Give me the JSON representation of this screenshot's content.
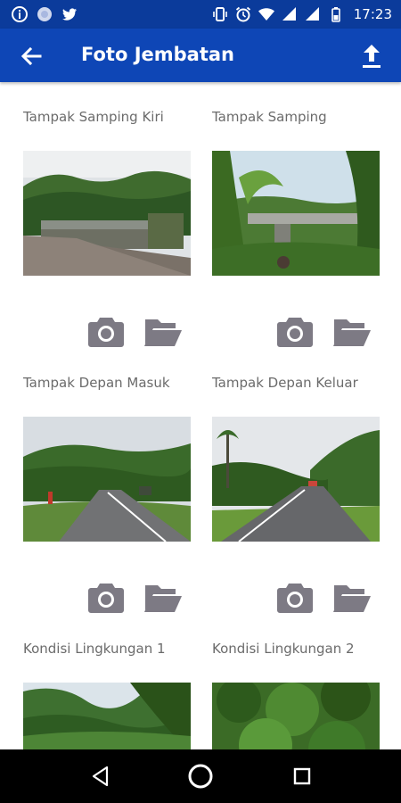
{
  "status_bar": {
    "time": "17:23",
    "left_icons": [
      "info-icon",
      "circle-app-icon",
      "twitter-icon"
    ],
    "right_icons": [
      "vibrate-icon",
      "alarm-icon",
      "wifi-icon",
      "signal-icon",
      "signal-icon",
      "battery-icon"
    ]
  },
  "app_bar": {
    "title": "Foto Jembatan",
    "back_icon": "arrow-left-icon",
    "action_icon": "upload-icon"
  },
  "photos": [
    {
      "label": "Tampak Samping Kiri",
      "scene": "bridge-side"
    },
    {
      "label": "Tampak Samping",
      "scene": "bridge-under"
    },
    {
      "label": "Tampak Depan Masuk",
      "scene": "road-entry"
    },
    {
      "label": "Tampak Depan Keluar",
      "scene": "road-exit"
    },
    {
      "label": "Kondisi Lingkungan 1",
      "scene": "forest-1"
    },
    {
      "label": "Kondisi Lingkungan 2",
      "scene": "forest-2"
    }
  ],
  "actions": {
    "camera_icon": "camera-icon",
    "folder_icon": "folder-open-icon"
  },
  "colors": {
    "status_bar": "#0b3b9b",
    "app_bar": "#0e46b6",
    "icon_gray": "#7d7a84",
    "label_text": "#6b6b6b"
  }
}
